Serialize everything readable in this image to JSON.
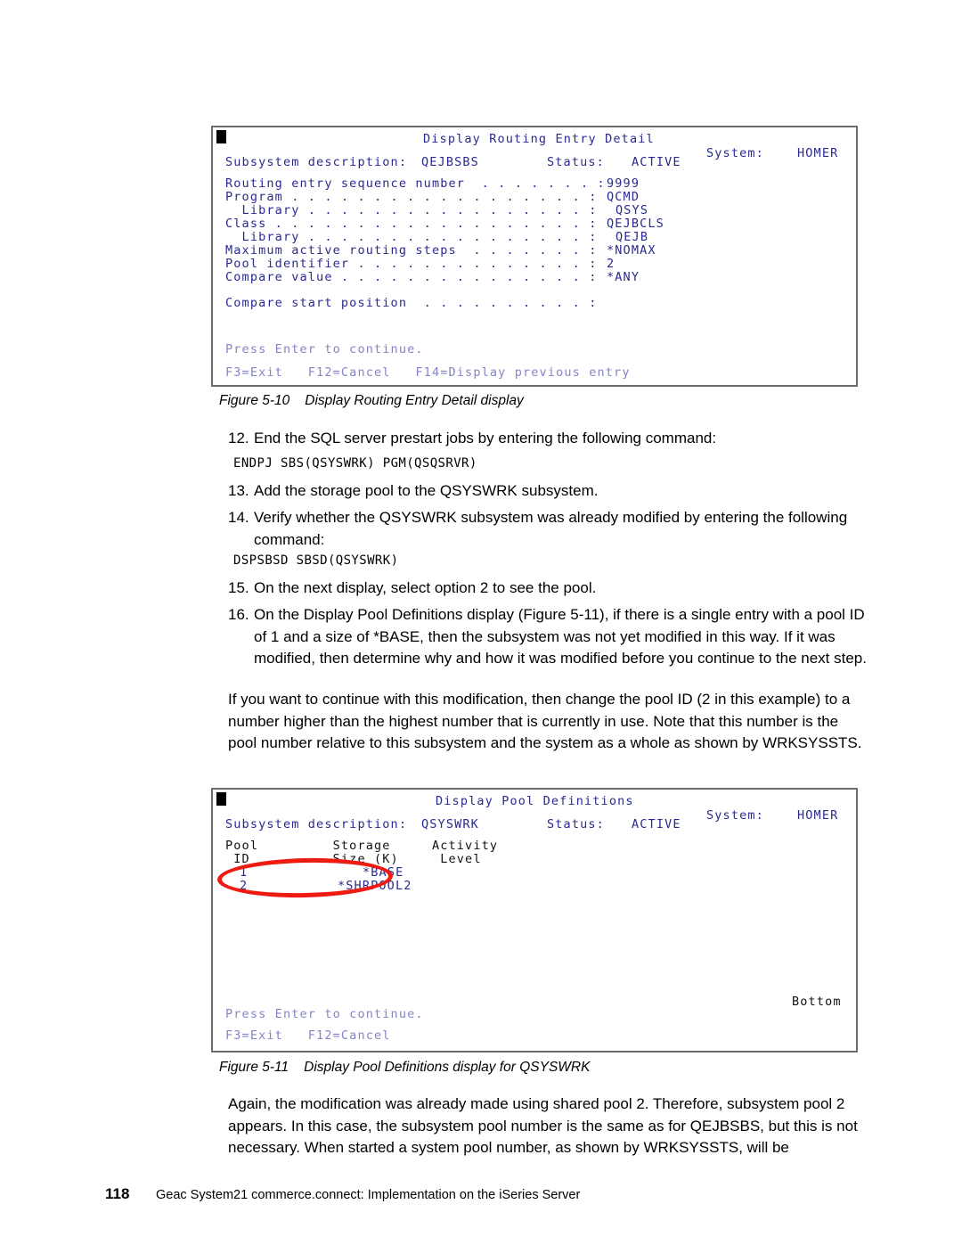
{
  "document": {
    "footer": {
      "page_number": "118",
      "title": "Geac System21 commerce.connect: Implementation on the iSeries Server"
    }
  },
  "figure_5_10": {
    "caption_number": "Figure 5-10",
    "caption_text": "Display Routing Entry Detail display",
    "screen": {
      "title": "Display Routing Entry Detail",
      "system_label": "System:",
      "system_value": "HOMER",
      "subsystem_label": "Subsystem description:",
      "subsystem_value": "QEJBSBS",
      "status_label": "Status:",
      "status_value": "ACTIVE",
      "fields": [
        {
          "label": "Routing entry sequence number  . . . . . . . :",
          "value": "9999"
        },
        {
          "label": "Program . . . . . . . . . . . . . . . . . . :",
          "value": "QCMD"
        },
        {
          "label": "  Library . . . . . . . . . . . . . . . . . :",
          "value": "QSYS"
        },
        {
          "label": "Class . . . . . . . . . . . . . . . . . . . :",
          "value": "QEJBCLS"
        },
        {
          "label": "  Library . . . . . . . . . . . . . . . . . :",
          "value": "QEJB"
        },
        {
          "label": "Maximum active routing steps  . . . . . . . :",
          "value": "*NOMAX"
        },
        {
          "label": "Pool identifier . . . . . . . . . . . . . . :",
          "value": "2"
        },
        {
          "label": "Compare value . . . . . . . . . . . . . . . :",
          "value": "*ANY"
        }
      ],
      "compare_start_position": "Compare start position  . . . . . . . . . . :",
      "press_enter": "Press Enter to continue.",
      "function_keys": "F3=Exit   F12=Cancel   F14=Display previous entry"
    }
  },
  "figure_5_11": {
    "caption_number": "Figure 5-11",
    "caption_text": "Display Pool Definitions display for QSYSWRK",
    "screen": {
      "title": "Display Pool Definitions",
      "system_label": "System:",
      "system_value": "HOMER",
      "subsystem_label": "Subsystem description:",
      "subsystem_value": "QSYSWRK",
      "status_label": "Status:",
      "status_value": "ACTIVE",
      "table": {
        "headers_line1": "Pool         Storage     Activity",
        "headers_line2": " ID          Size (K)     Level",
        "rows": [
          {
            "pool_id": "1",
            "storage_size": "*BASE",
            "activity_level": ""
          },
          {
            "pool_id": "2",
            "storage_size": "*SHRPOOL2",
            "activity_level": ""
          }
        ]
      },
      "bottom_indicator": "Bottom",
      "press_enter": "Press Enter to continue.",
      "function_keys": "F3=Exit   F12=Cancel"
    },
    "annotation": {
      "shape": "ellipse",
      "color": "#EE1B11",
      "highlights": "pool rows 1 and 2"
    }
  },
  "steps": [
    {
      "number": "12.",
      "text": "End the SQL server prestart jobs by entering the following command:",
      "code": "ENDPJ SBS(QSYSWRK) PGM(QSQSRVR)"
    },
    {
      "number": "13.",
      "text": "Add the storage pool to the QSYSWRK subsystem.",
      "code": ""
    },
    {
      "number": "14.",
      "text": "Verify whether the QSYSWRK subsystem was already modified by entering the following command:",
      "code": "DSPSBSD SBSD(QSYSWRK)"
    },
    {
      "number": "15.",
      "text": "On the next display, select option 2 to see the pool.",
      "code": ""
    },
    {
      "number": "16.",
      "text": "On the Display Pool Definitions display (Figure 5-11), if there is a single entry with a pool ID of 1 and a size of *BASE, then the subsystem was not yet modified in this way. If it was modified, then determine why and how it was modified before you continue to the next step.",
      "code": ""
    }
  ],
  "paragraphs": {
    "after_step_16": "If you want to continue with this modification, then change the pool ID (2 in this example) to a number higher than the highest number that is currently in use. Note that this number is the pool number relative to this subsystem and the system as a whole as shown by WRKSYSSTS.",
    "after_figure_5_11": "Again, the modification was already made using shared pool 2. Therefore, subsystem pool 2 appears. In this case, the subsystem pool number is the same as for QEJBSBS, but this is not necessary. When started a system pool number, as shown by WRKSYSSTS, will be"
  }
}
